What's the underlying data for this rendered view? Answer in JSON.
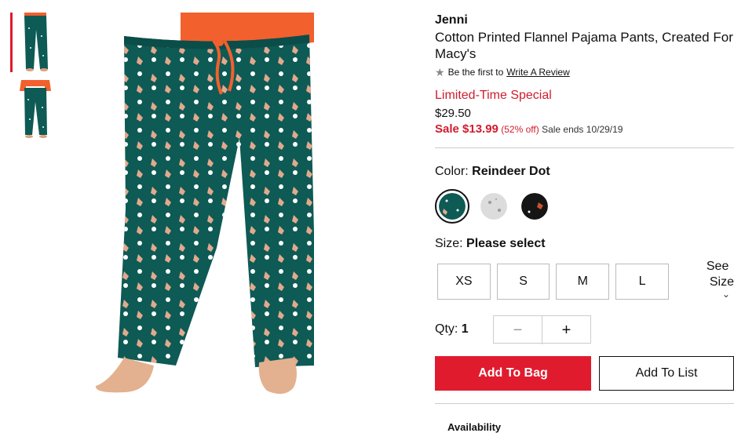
{
  "product": {
    "brand": "Jenni",
    "title": "Cotton Printed Flannel Pajama Pants, Created For Macy's",
    "review_prefix": "Be the first to",
    "review_link": "Write A Review",
    "promo": "Limited-Time Special",
    "original_price": "$29.50",
    "sale_price": "Sale $13.99",
    "percent_off": "(52% off)",
    "sale_ends": "Sale ends 10/29/19"
  },
  "color": {
    "label": "Color:",
    "selected": "Reindeer Dot",
    "swatches": [
      {
        "name": "Reindeer Dot",
        "color": "#0e5a55"
      },
      {
        "name": "Gray Print",
        "color": "#dcdcdc"
      },
      {
        "name": "Black Print",
        "color": "#151515"
      }
    ]
  },
  "size": {
    "label": "Size:",
    "selected": "Please select",
    "options": [
      "XS",
      "S",
      "M",
      "L"
    ],
    "chart_line1": "See",
    "chart_line2": "Size"
  },
  "quantity": {
    "label": "Qty:",
    "value": "1",
    "minus": "−",
    "plus": "+"
  },
  "buttons": {
    "add_to_bag": "Add To Bag",
    "add_to_list": "Add To List"
  },
  "availability": "Availability",
  "icons": {
    "star": "star-icon",
    "chevron": "chevron-down-icon"
  },
  "colors": {
    "accent_red": "#e11b2e",
    "pant_green": "#0e5a55",
    "top_orange": "#f2602d"
  }
}
